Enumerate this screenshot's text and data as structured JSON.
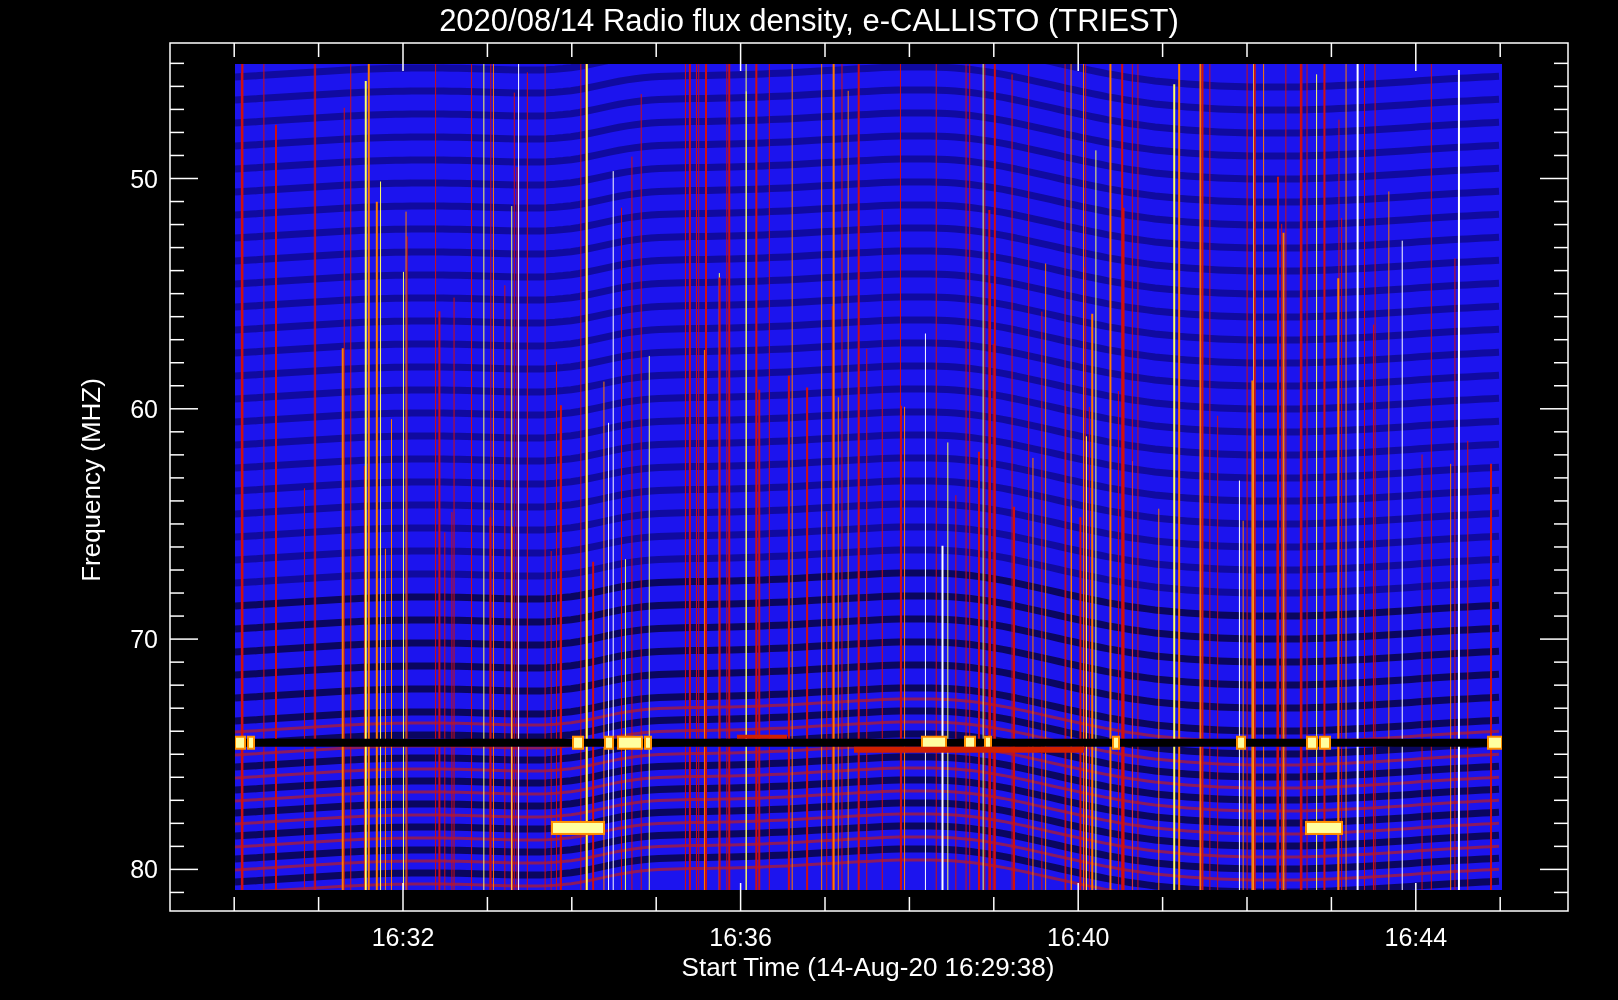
{
  "plot": {
    "title": "2020/08/14  Radio flux density, e-CALLISTO (TRIEST)",
    "ylabel": "Frequency (MHZ)",
    "xlabel": "Start Time (14-Aug-20 16:29:38)",
    "yticks": [
      "50",
      "60",
      "70",
      "80"
    ],
    "xticks": [
      "16:32",
      "16:36",
      "16:40",
      "16:44"
    ]
  }
}
